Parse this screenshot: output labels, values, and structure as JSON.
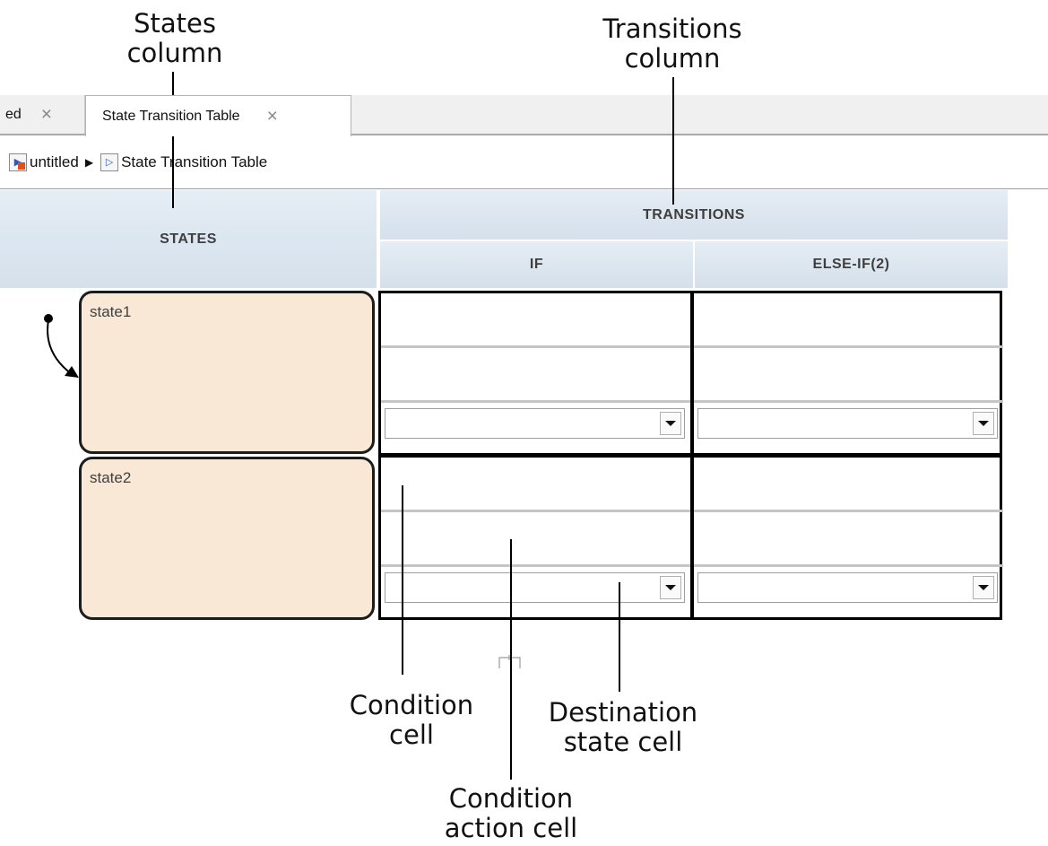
{
  "callouts": {
    "states_column": "States\ncolumn",
    "transitions_column": "Transitions\ncolumn",
    "condition_cell": "Condition\ncell",
    "destination_state_cell": "Destination\nstate cell",
    "condition_action_cell": "Condition\naction cell"
  },
  "tabs": [
    {
      "label": "ed",
      "close": "×"
    },
    {
      "label": "State Transition Table",
      "close": "×"
    }
  ],
  "breadcrumb": [
    {
      "label": "untitled",
      "icon": "model-icon"
    },
    {
      "label": "State Transition Table",
      "icon": "chart-icon"
    }
  ],
  "table": {
    "states_header": "STATES",
    "transitions_header": "TRANSITIONS",
    "if_header": "IF",
    "else_if_header": "ELSE-IF(2)",
    "states": [
      "state1",
      "state2"
    ]
  },
  "colors": {
    "state_fill": "#f9e8d6",
    "header_fill": "#dce6f0"
  }
}
